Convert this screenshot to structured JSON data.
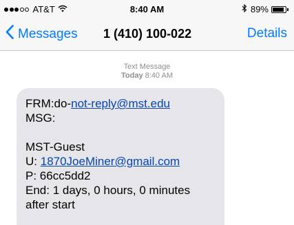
{
  "status_bar": {
    "signal_filled": 3,
    "signal_total": 5,
    "carrier": "AT&T",
    "wifi_icon": "wifi-icon",
    "time": "8:40 AM",
    "bluetooth_icon": "bluetooth-icon",
    "battery_percent": "89%",
    "battery_level": 0.89
  },
  "nav": {
    "back_label": "Messages",
    "title": "1 (410) 100-022",
    "details_label": "Details"
  },
  "thread": {
    "message_type": "Text Message",
    "day": "Today",
    "time": "8:40 AM"
  },
  "message": {
    "from_prefix": "FRM:do-",
    "from_link": "not-reply@mst.edu",
    "msg_label": "MSG:",
    "network": "MST-Guest",
    "user_prefix": "U: ",
    "user_link": "1870JoeMiner@gmail.com",
    "password": "P: 66cc5dd2",
    "end_line1": "End: 1 days, 0 hours, 0 minutes",
    "end_line2": "after start"
  },
  "colors": {
    "accent": "#007aff",
    "bubble": "#e5e5ea",
    "link": "#0645ad",
    "meta": "#8e8e93"
  }
}
